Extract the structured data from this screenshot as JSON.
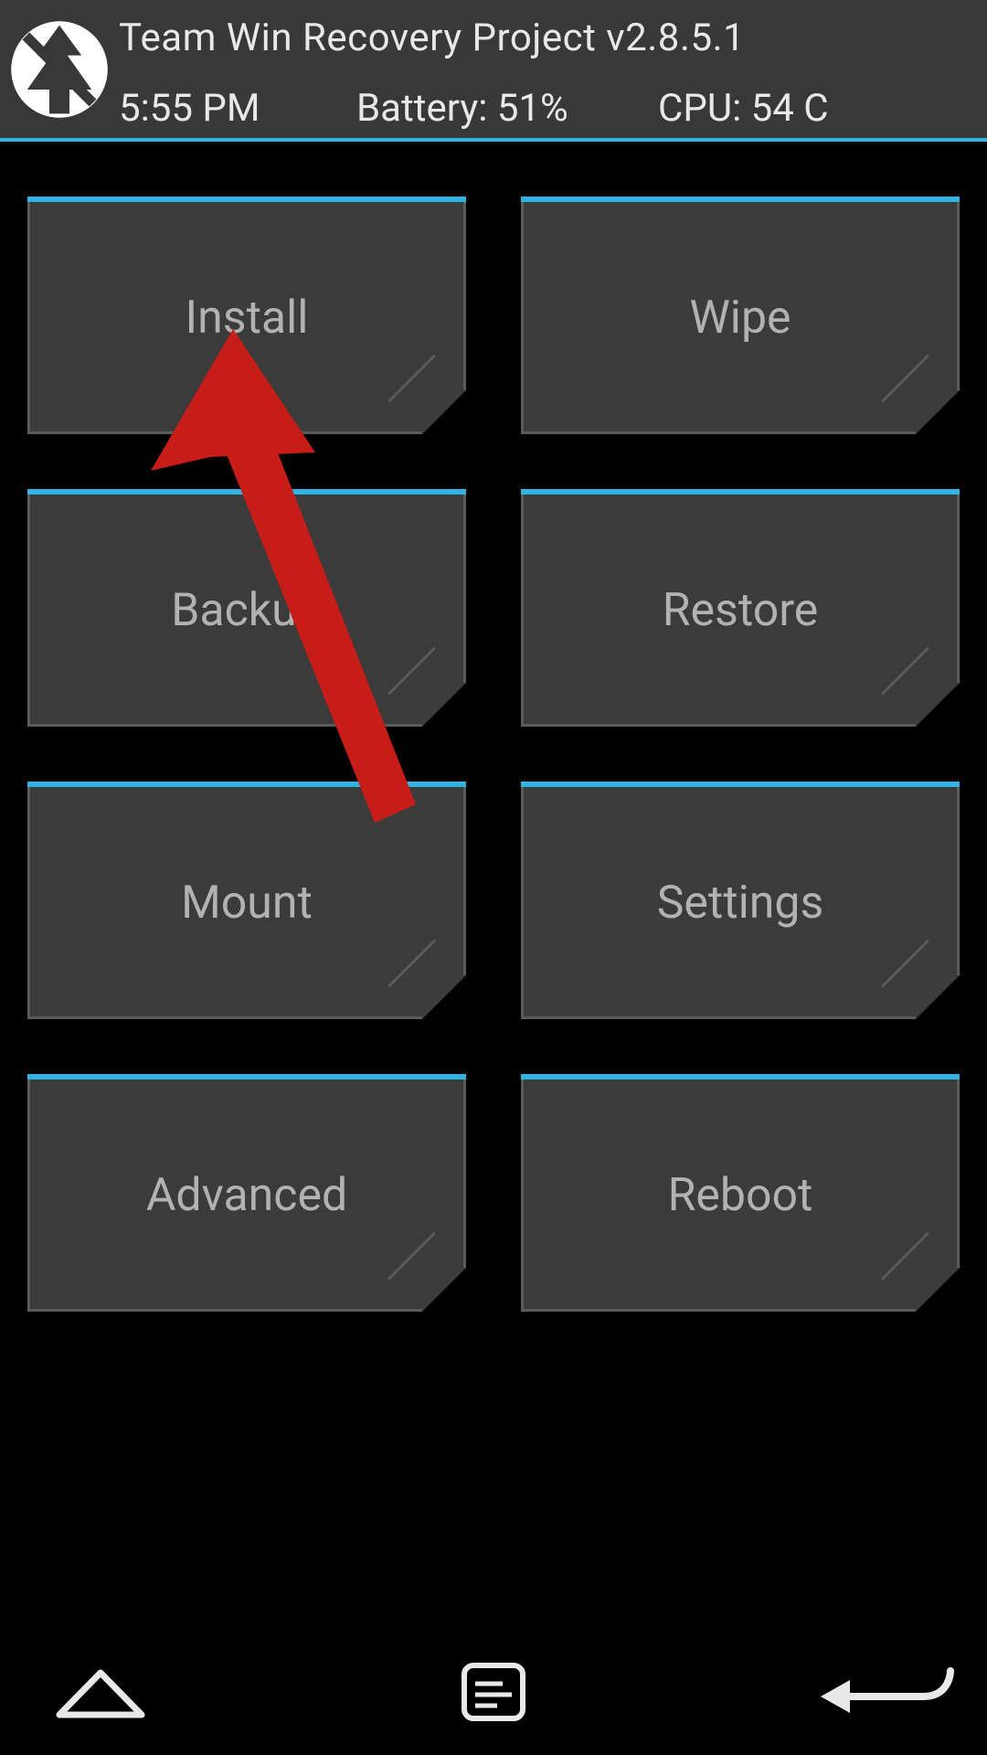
{
  "header": {
    "title": "Team Win Recovery Project  v2.8.5.1",
    "time": "5:55 PM",
    "battery": "Battery: 51%",
    "cpu": "CPU: 54 C"
  },
  "buttons": {
    "install": "Install",
    "wipe": "Wipe",
    "backup": "Backup",
    "restore": "Restore",
    "mount": "Mount",
    "settings": "Settings",
    "advanced": "Advanced",
    "reboot": "Reboot"
  },
  "colors": {
    "accent": "#31b4e4",
    "arrow": "#c61d19"
  },
  "annotation": {
    "arrow_target": "install"
  }
}
